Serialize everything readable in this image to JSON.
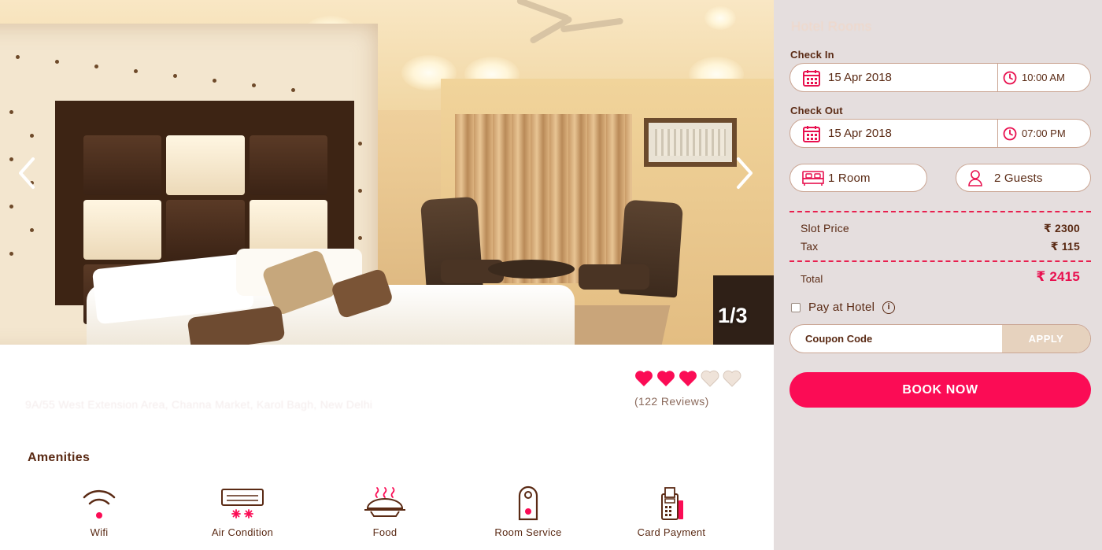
{
  "gallery": {
    "prev_icon": "chevron-left-icon",
    "next_icon": "chevron-right-icon",
    "counter": "1/3"
  },
  "hotel": {
    "address": "9A/55 West Extension Area, Channa Market, Karol Bagh, New Delhi",
    "rating": {
      "value": 3,
      "max": 5,
      "icon": "heart-icon"
    },
    "reviews": "(122 Reviews)"
  },
  "amenities": {
    "title": "Amenities",
    "items": [
      {
        "label": "Wifi",
        "icon": "wifi-icon"
      },
      {
        "label": "Air Condition",
        "icon": "air-condition-icon"
      },
      {
        "label": "Food",
        "icon": "food-icon"
      },
      {
        "label": "Room Service",
        "icon": "room-service-icon"
      },
      {
        "label": "Card Payment",
        "icon": "card-payment-icon"
      }
    ]
  },
  "booking": {
    "title": "Hotel Rooms",
    "check_in": {
      "label": "Check In",
      "date": "15 Apr 2018",
      "time": "10:00 AM"
    },
    "check_out": {
      "label": "Check Out",
      "date": "15 Apr 2018",
      "time": "07:00 PM"
    },
    "rooms": "1 Room",
    "guests": "2 Guests",
    "slot_price": {
      "label": "Slot Price",
      "value": "₹ 2300"
    },
    "tax": {
      "label": "Tax",
      "value": "₹ 115"
    },
    "total": {
      "label": "Total",
      "value": "₹ 2415"
    },
    "pay_at_hotel": {
      "label": "Pay at Hotel",
      "checked": false
    },
    "coupon": {
      "placeholder": "Coupon Code",
      "value": ""
    },
    "apply_label": "APPLY",
    "book_label": "BOOK NOW"
  },
  "colors": {
    "accent": "#fb0c55",
    "brown": "#5a2a14",
    "panel_bg": "#e5dede",
    "border": "#caa593",
    "heart_empty": "#efe3d9"
  }
}
